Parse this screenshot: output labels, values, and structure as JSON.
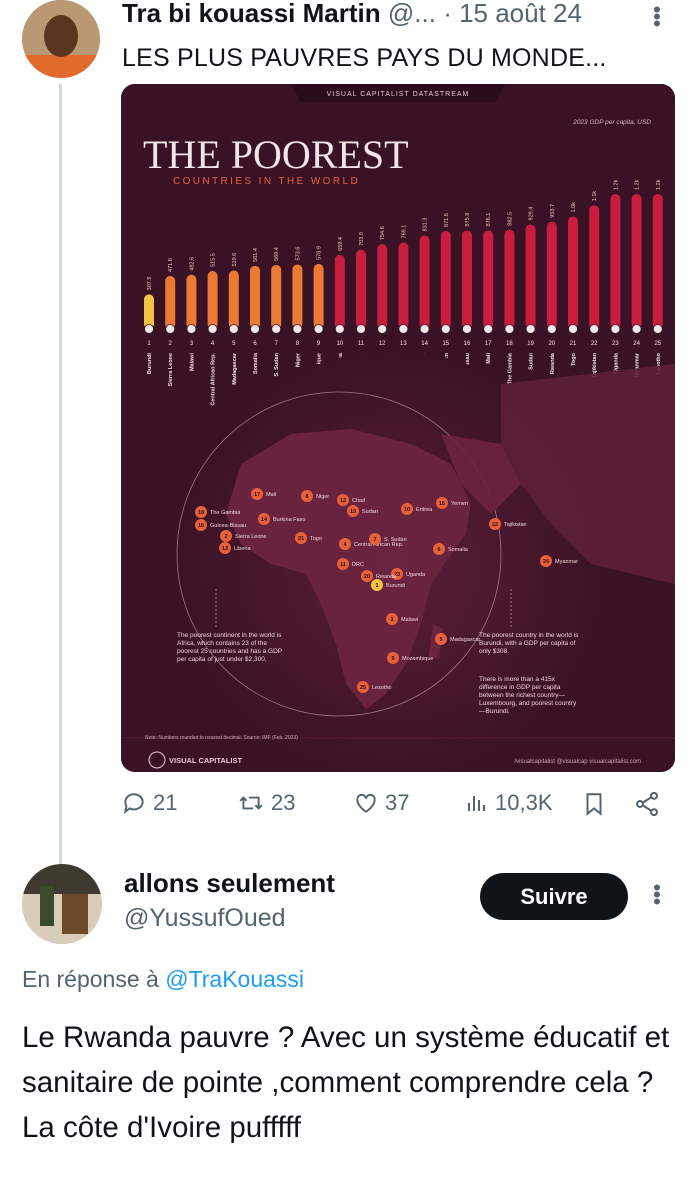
{
  "original_tweet": {
    "author_name": "Tra bi kouassi Martin",
    "handle_trunc": "@...",
    "date": "· 15 août 24",
    "text": "LES PLUS PAUVRES PAYS DU MONDE...",
    "stats": {
      "replies": "21",
      "retweets": "23",
      "likes": "37",
      "views": "10,3K"
    }
  },
  "infographic": {
    "header_banner": "VISUAL CAPITALIST DATASTREAM",
    "title": "THE POOREST",
    "subtitle": "COUNTRIES IN THE WORLD",
    "unit_label": "2023 GDP per capita, USD",
    "left_note": "The poorest continent in the world is Africa, which contains 23 of the poorest 25 countries and has a GDP per capita of just under $2,300.",
    "right_note_1": "The poorest country in the world is Burundi, with a GDP per capita of only $308.",
    "right_note_2": "There is more than a 415x difference in GDP per capita between the richest country—Luxembourg, and poorest country—Burundi.",
    "source_note": "Note: Numbers rounded to nearest decimal. Source: IMF (Feb, 2023)",
    "brand": "VISUAL CAPITALIST",
    "footer_links": "/visualcapitalist   @visualcap   visualcapitalist.com",
    "map_labels": [
      {
        "name": "Mali",
        "rank": "17"
      },
      {
        "name": "Niger",
        "rank": "8"
      },
      {
        "name": "Chad",
        "rank": "12"
      },
      {
        "name": "Sudan",
        "rank": "19"
      },
      {
        "name": "Eritrea",
        "rank": "10"
      },
      {
        "name": "Yemen",
        "rank": "15"
      },
      {
        "name": "The Gambia",
        "rank": "18"
      },
      {
        "name": "Guinea-Bissau",
        "rank": "16"
      },
      {
        "name": "Burkina Faso",
        "rank": "14"
      },
      {
        "name": "Sierra Leone",
        "rank": "2"
      },
      {
        "name": "Togo",
        "rank": "21"
      },
      {
        "name": "Liberia",
        "rank": "13"
      },
      {
        "name": "Central African Rep.",
        "rank": "4"
      },
      {
        "name": "S. Sudan",
        "rank": "7"
      },
      {
        "name": "Somalia",
        "rank": "6"
      },
      {
        "name": "DRC",
        "rank": "11"
      },
      {
        "name": "Uganda",
        "rank": "23"
      },
      {
        "name": "Rwanda",
        "rank": "20"
      },
      {
        "name": "Burundi",
        "rank": "1"
      },
      {
        "name": "Malawi",
        "rank": "3"
      },
      {
        "name": "Madagascar",
        "rank": "5"
      },
      {
        "name": "Mozambique",
        "rank": "9"
      },
      {
        "name": "Lesotho",
        "rank": "25"
      },
      {
        "name": "Tajikistan",
        "rank": "22"
      },
      {
        "name": "Myanmar",
        "rank": "24"
      }
    ]
  },
  "chart_data": {
    "type": "bar",
    "title": "THE POOREST",
    "subtitle": "COUNTRIES IN THE WORLD",
    "ylabel": "2023 GDP per capita, USD",
    "categories": [
      "Burundi",
      "Sierra Leone",
      "Malawi",
      "Central African Rep.",
      "Madagascar",
      "Somalia",
      "S. Sudan",
      "Niger",
      "Mozambique",
      "Eritrea",
      "DRC",
      "Chad",
      "Liberia",
      "Burkina Faso",
      "Yemen",
      "Guinea-Bissau",
      "Mali",
      "The Gambia",
      "Sudan",
      "Rwanda",
      "Togo",
      "Tajikistan",
      "Uganda",
      "Myanmar",
      "Lesotho"
    ],
    "ranks": [
      "1",
      "2",
      "3",
      "4",
      "5",
      "6",
      "7",
      "8",
      "9",
      "10",
      "11",
      "12",
      "13",
      "14",
      "15",
      "16",
      "17",
      "18",
      "19",
      "20",
      "21",
      "22",
      "23",
      "24",
      "25"
    ],
    "values": [
      307.9,
      471.6,
      482.6,
      515.5,
      519.6,
      561.4,
      569.4,
      573.6,
      578.9,
      659.4,
      703.9,
      754.6,
      769.1,
      831.3,
      871.6,
      875.8,
      876.1,
      882.5,
      929.4,
      953.7,
      1000,
      1100,
      1200,
      1200,
      1200
    ],
    "value_labels": [
      "307.9",
      "471.6",
      "482.6",
      "515.5",
      "519.6",
      "561.4",
      "569.4",
      "573.6",
      "578.9",
      "659.4",
      "703.9",
      "754.6",
      "769.1",
      "831.3",
      "871.6",
      "875.8",
      "876.1",
      "882.5",
      "929.4",
      "953.7",
      "1.0k",
      "1.1k",
      "1.2k",
      "1.2k",
      "1.2k"
    ],
    "ylim": [
      0,
      1200
    ],
    "grid": false
  },
  "reply": {
    "author_name": "allons seulement",
    "handle": "@YussufOued",
    "follow_label": "Suivre",
    "in_reply_prefix": "En réponse à",
    "in_reply_to": "@TraKouassi",
    "text": "Le Rwanda pauvre ? Avec un système éducatif et sanitaire de pointe ,comment comprendre cela ? La côte d'Ivoire pufffff"
  },
  "colors": {
    "accent": "#1d9bf0",
    "card_bg": "#3a1226",
    "bar_low": "#f3c443",
    "bar_mid": "#e8603a",
    "bar_high": "#c1173b"
  }
}
